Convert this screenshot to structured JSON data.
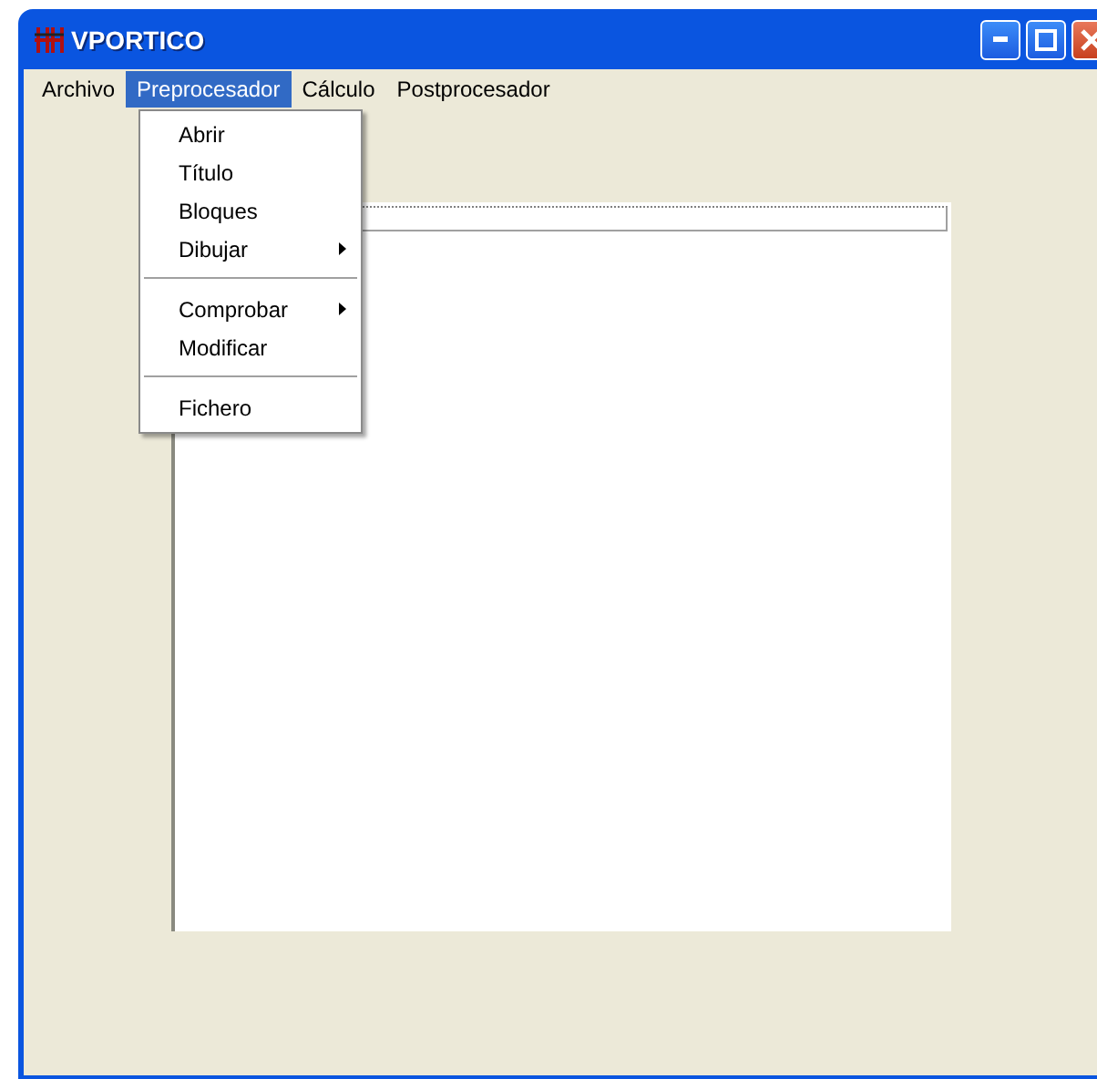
{
  "window": {
    "title": "VPORTICO"
  },
  "menu_bar": [
    {
      "label": "Archivo",
      "selected": false
    },
    {
      "label": "Preprocesador",
      "selected": true
    },
    {
      "label": "Cálculo",
      "selected": false
    },
    {
      "label": "Postprocesador",
      "selected": false
    }
  ],
  "dropdown": [
    {
      "kind": "item",
      "label": "Abrir"
    },
    {
      "kind": "item",
      "label": "Título"
    },
    {
      "kind": "item",
      "label": "Bloques"
    },
    {
      "kind": "submenu",
      "label": "Dibujar"
    },
    {
      "kind": "separator"
    },
    {
      "kind": "submenu",
      "label": "Comprobar"
    },
    {
      "kind": "item",
      "label": "Modificar"
    },
    {
      "kind": "separator"
    },
    {
      "kind": "item",
      "label": "Fichero"
    }
  ]
}
